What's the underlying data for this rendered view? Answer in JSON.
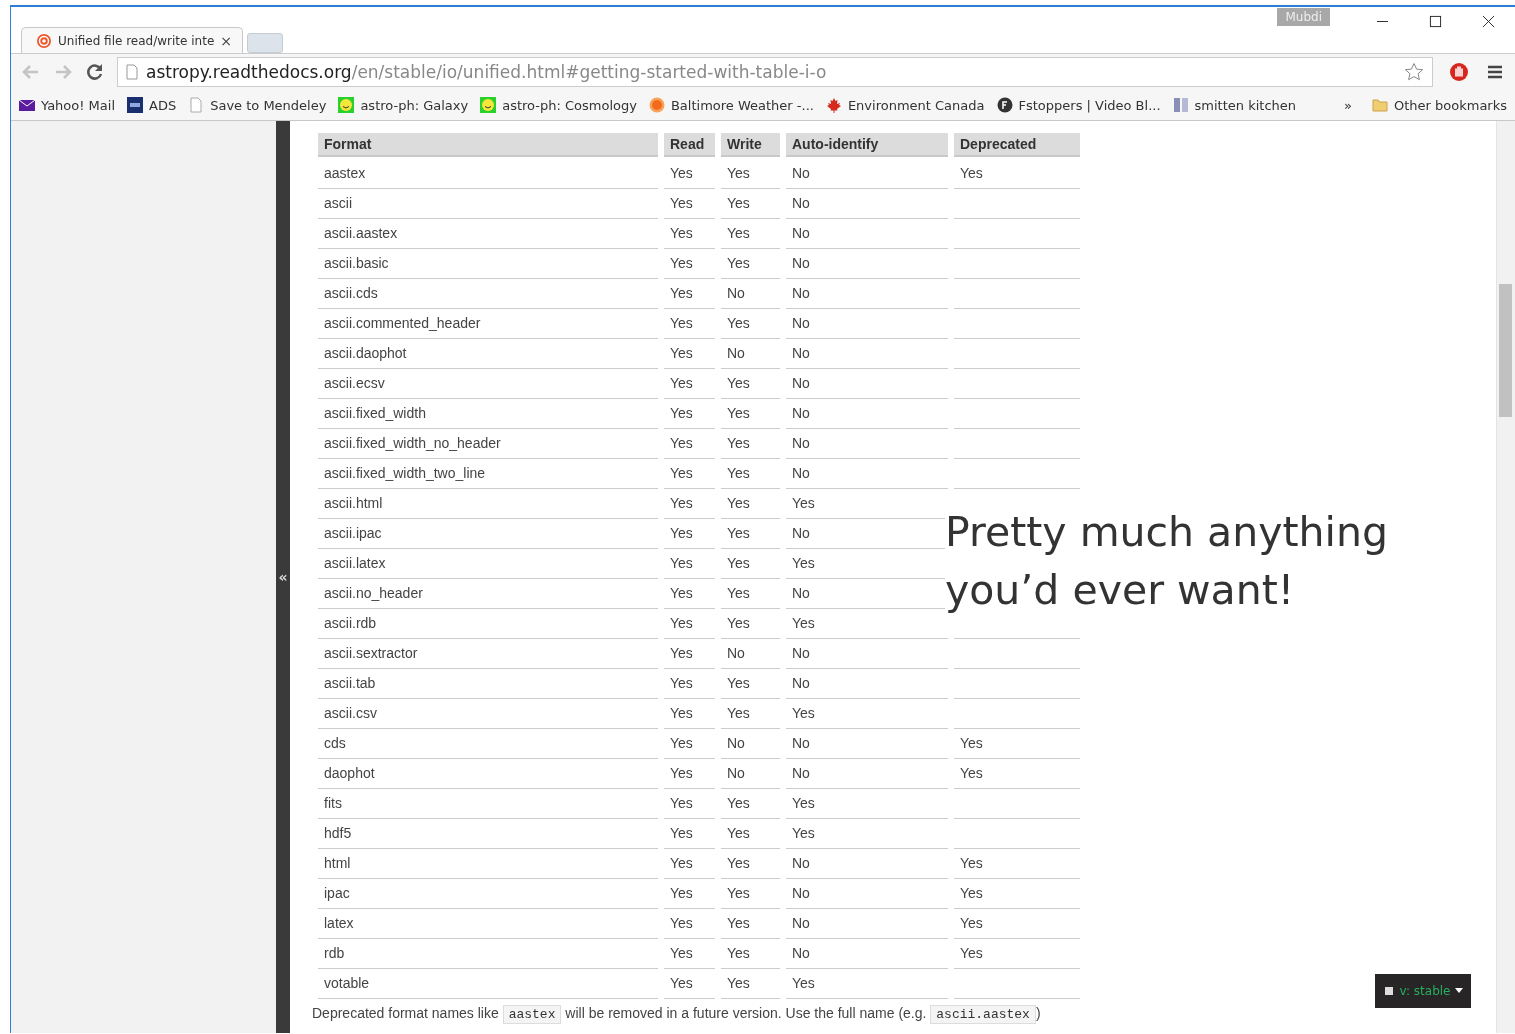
{
  "window": {
    "profile": "Mubdi"
  },
  "tabs": [
    {
      "title": "Unified file read/write inte",
      "close": "×"
    }
  ],
  "toolbar": {
    "address_host": "astropy.readthedocs.org",
    "address_path": "/en/stable/io/unified.html#getting-started-with-table-i-o"
  },
  "bookmarks": [
    {
      "kind": "mail",
      "label": "Yahoo! Mail"
    },
    {
      "kind": "ads",
      "label": "ADS"
    },
    {
      "kind": "page",
      "label": "Save to Mendeley"
    },
    {
      "kind": "smiley",
      "label": "astro-ph: Galaxy"
    },
    {
      "kind": "smiley",
      "label": "astro-ph: Cosmology"
    },
    {
      "kind": "sun",
      "label": "Baltimore Weather -..."
    },
    {
      "kind": "maple",
      "label": "Environment Canada"
    },
    {
      "kind": "fs",
      "label": "Fstoppers | Video Bl..."
    },
    {
      "kind": "sk",
      "label": "smitten kitchen"
    }
  ],
  "bookmarks_overflow": "»",
  "other_bookmarks": "Other bookmarks",
  "sidebar": {
    "toggle": "«"
  },
  "table": {
    "columns": [
      "Format",
      "Read",
      "Write",
      "Auto-identify",
      "Deprecated"
    ],
    "rows": [
      [
        "aastex",
        "Yes",
        "Yes",
        "No",
        "Yes"
      ],
      [
        "ascii",
        "Yes",
        "Yes",
        "No"
      ],
      [
        "ascii.aastex",
        "Yes",
        "Yes",
        "No"
      ],
      [
        "ascii.basic",
        "Yes",
        "Yes",
        "No"
      ],
      [
        "ascii.cds",
        "Yes",
        "No",
        "No"
      ],
      [
        "ascii.commented_header",
        "Yes",
        "Yes",
        "No"
      ],
      [
        "ascii.daophot",
        "Yes",
        "No",
        "No"
      ],
      [
        "ascii.ecsv",
        "Yes",
        "Yes",
        "No"
      ],
      [
        "ascii.fixed_width",
        "Yes",
        "Yes",
        "No"
      ],
      [
        "ascii.fixed_width_no_header",
        "Yes",
        "Yes",
        "No"
      ],
      [
        "ascii.fixed_width_two_line",
        "Yes",
        "Yes",
        "No"
      ],
      [
        "ascii.html",
        "Yes",
        "Yes",
        "Yes"
      ],
      [
        "ascii.ipac",
        "Yes",
        "Yes",
        "No"
      ],
      [
        "ascii.latex",
        "Yes",
        "Yes",
        "Yes"
      ],
      [
        "ascii.no_header",
        "Yes",
        "Yes",
        "No"
      ],
      [
        "ascii.rdb",
        "Yes",
        "Yes",
        "Yes"
      ],
      [
        "ascii.sextractor",
        "Yes",
        "No",
        "No"
      ],
      [
        "ascii.tab",
        "Yes",
        "Yes",
        "No"
      ],
      [
        "ascii.csv",
        "Yes",
        "Yes",
        "Yes"
      ],
      [
        "cds",
        "Yes",
        "No",
        "No",
        "Yes"
      ],
      [
        "daophot",
        "Yes",
        "No",
        "No",
        "Yes"
      ],
      [
        "fits",
        "Yes",
        "Yes",
        "Yes"
      ],
      [
        "hdf5",
        "Yes",
        "Yes",
        "Yes"
      ],
      [
        "html",
        "Yes",
        "Yes",
        "No",
        "Yes"
      ],
      [
        "ipac",
        "Yes",
        "Yes",
        "No",
        "Yes"
      ],
      [
        "latex",
        "Yes",
        "Yes",
        "No",
        "Yes"
      ],
      [
        "rdb",
        "Yes",
        "Yes",
        "No",
        "Yes"
      ],
      [
        "votable",
        "Yes",
        "Yes",
        "Yes"
      ]
    ]
  },
  "footnote": [
    {
      "kind": "text",
      "text": "Deprecated format names like "
    },
    {
      "kind": "code",
      "text": "aastex"
    },
    {
      "kind": "text",
      "text": " will be removed in a future version. Use the full name (e.g. "
    },
    {
      "kind": "code",
      "text": "ascii.aastex"
    },
    {
      "kind": "text",
      "text": ")"
    }
  ],
  "version_badge": "v: stable",
  "caption": [
    "Pretty much anything",
    "you’d ever want!"
  ]
}
